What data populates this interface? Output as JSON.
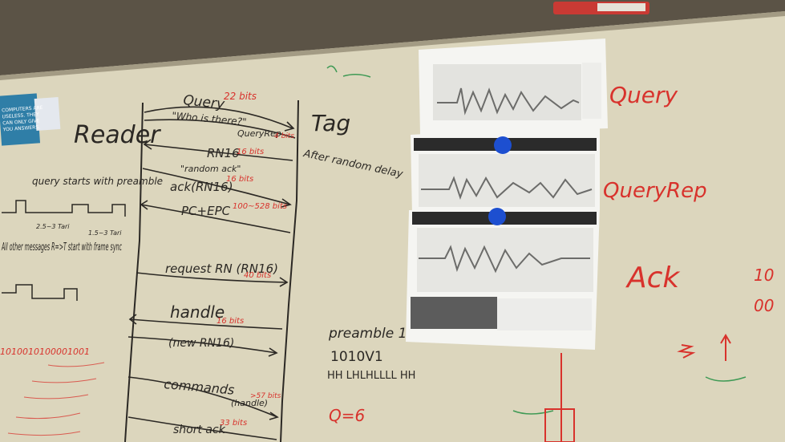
{
  "colors": {
    "wall": "#5b5346",
    "board": "#dcd6bd",
    "board_shadow": "#b9b199",
    "ink_black": "#2b2824",
    "ink_red": "#d8322c",
    "ink_green": "#3f9a55",
    "magnet_blue": "#1d4fd0",
    "paper": "#f5f5f2"
  },
  "board": {
    "reader_label": "Reader",
    "tag_label": "Tag",
    "tag_note": "After random delay",
    "messages": [
      {
        "label": "Query",
        "bits": "22 bits",
        "note": "\"Who is there?\""
      },
      {
        "label": "QueryRep",
        "bits": "4 bits",
        "note": ""
      },
      {
        "label": "RN16",
        "bits": "16 bits",
        "note": "\"random ack\""
      },
      {
        "label": "ack(RN16)",
        "bits": "16 bits",
        "note": ""
      },
      {
        "label": "PC+EPC",
        "bits": "100~528 bits",
        "note": ""
      },
      {
        "label": "request RN (RN16)",
        "bits": "40 bits",
        "note": ""
      },
      {
        "label": "handle",
        "bits": "16 bits",
        "note": "(new RN16)"
      },
      {
        "label": "commands",
        "bits": ">57 bits",
        "note": "(handle)"
      },
      {
        "label": "short ack",
        "bits": "33 bits",
        "note": ""
      }
    ],
    "left_notes": {
      "preamble": "query starts with preamble",
      "timing": [
        "2.5~3 Tari",
        "1.5~3 Tari"
      ],
      "other": "All other messages R=>T start with frame sync",
      "binary": "1010010100001001",
      "sticker": "COMPUTERS ARE USELESS. THEY CAN ONLY GIVE YOU ANSWERS."
    },
    "center_notes": {
      "preamble_line": "preamble 1=>R",
      "bits_line": "1010V1",
      "hl_line": "HH LHLHLLLL HH",
      "q": "Q=6"
    },
    "right_labels": [
      "Query",
      "QueryRep",
      "Ack"
    ],
    "far_right": [
      "10",
      "00"
    ]
  }
}
